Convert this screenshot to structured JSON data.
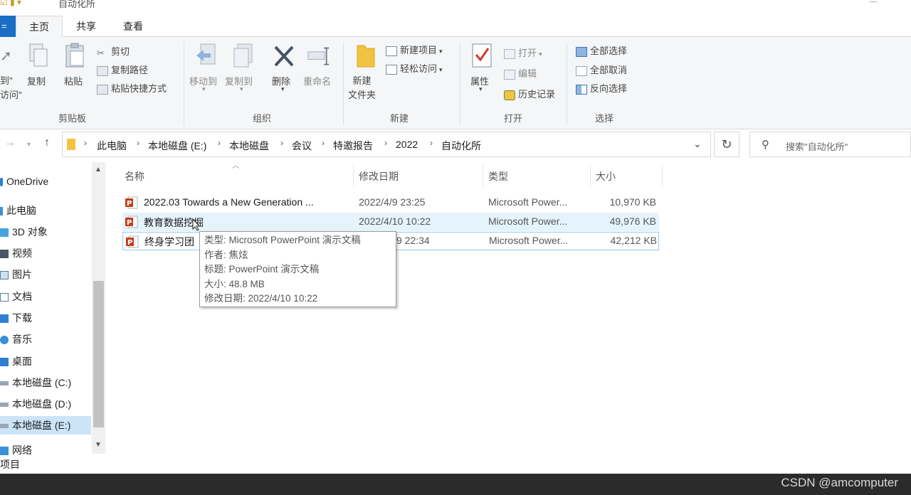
{
  "window": {
    "title": "自动化所"
  },
  "ribbon_tabs": [
    {
      "label": "主页"
    },
    {
      "label": "共享"
    },
    {
      "label": "查看"
    }
  ],
  "ribbon": {
    "clipboard": {
      "pin_label": "到\"\n访问\"",
      "copy": "复制",
      "paste": "粘贴",
      "cut": "剪切",
      "copy_path": "复制路径",
      "paste_shortcut": "粘贴快捷方式",
      "group": "剪贴板"
    },
    "organize": {
      "move_to": "移动到",
      "copy_to": "复制到",
      "delete": "删除",
      "rename": "重命名",
      "group": "组织"
    },
    "new": {
      "new_folder": "新建\n文件夹",
      "new_item": "新建项目",
      "easy_access": "轻松访问",
      "group": "新建"
    },
    "open": {
      "properties": "属性",
      "open": "打开",
      "edit": "编辑",
      "history": "历史记录",
      "group": "打开"
    },
    "select": {
      "select_all": "全部选择",
      "select_none": "全部取消",
      "invert": "反向选择",
      "group": "选择"
    }
  },
  "address": {
    "crumbs": [
      "此电脑",
      "本地磁盘 (E:)",
      "本地磁盘",
      "会议",
      "特邀报告",
      "2022",
      "自动化所"
    ],
    "search_placeholder": "搜索\"自动化所\""
  },
  "nav_pane": {
    "items": [
      {
        "label": "OneDrive",
        "icon": "cloud-icon"
      },
      {
        "label": "此电脑",
        "icon": "computer-icon"
      },
      {
        "label": "3D 对象",
        "icon": "cube-icon"
      },
      {
        "label": "视频",
        "icon": "video-icon"
      },
      {
        "label": "图片",
        "icon": "picture-icon"
      },
      {
        "label": "文档",
        "icon": "document-icon"
      },
      {
        "label": "下载",
        "icon": "download-icon"
      },
      {
        "label": "音乐",
        "icon": "music-icon"
      },
      {
        "label": "桌面",
        "icon": "desktop-icon"
      },
      {
        "label": "本地磁盘 (C:)",
        "icon": "drive-icon"
      },
      {
        "label": "本地磁盘 (D:)",
        "icon": "drive-icon"
      },
      {
        "label": "本地磁盘 (E:)",
        "icon": "drive-icon"
      }
    ],
    "partial_item": "网络"
  },
  "file_list": {
    "columns": {
      "name": "名称",
      "date": "修改日期",
      "type": "类型",
      "size": "大小"
    },
    "files": [
      {
        "name": "2022.03 Towards a New Generation ...",
        "date": "2022/4/9 23:25",
        "type": "Microsoft Power...",
        "size": "10,970 KB"
      },
      {
        "name": "教育数据挖掘",
        "date": "2022/4/10 10:22",
        "type": "Microsoft Power...",
        "size": "49,976 KB"
      },
      {
        "name": "终身学习团",
        "date": "9 22:34",
        "type": "Microsoft Power...",
        "size": "42,212 KB"
      }
    ]
  },
  "tooltip": {
    "type": "类型: Microsoft PowerPoint 演示文稿",
    "author": "作者: 焦炫",
    "title": "标题: PowerPoint 演示文稿",
    "size": "大小: 48.8 MB",
    "modified": "修改日期: 2022/4/10 10:22"
  },
  "status_bar": {
    "text": "项目"
  },
  "watermark": "CSDN @amcomputer",
  "colors": {
    "accent": "#1a6fc4",
    "selection": "#cce4f7",
    "hover": "#e5f3fb",
    "ppt": "#c43e1c"
  }
}
